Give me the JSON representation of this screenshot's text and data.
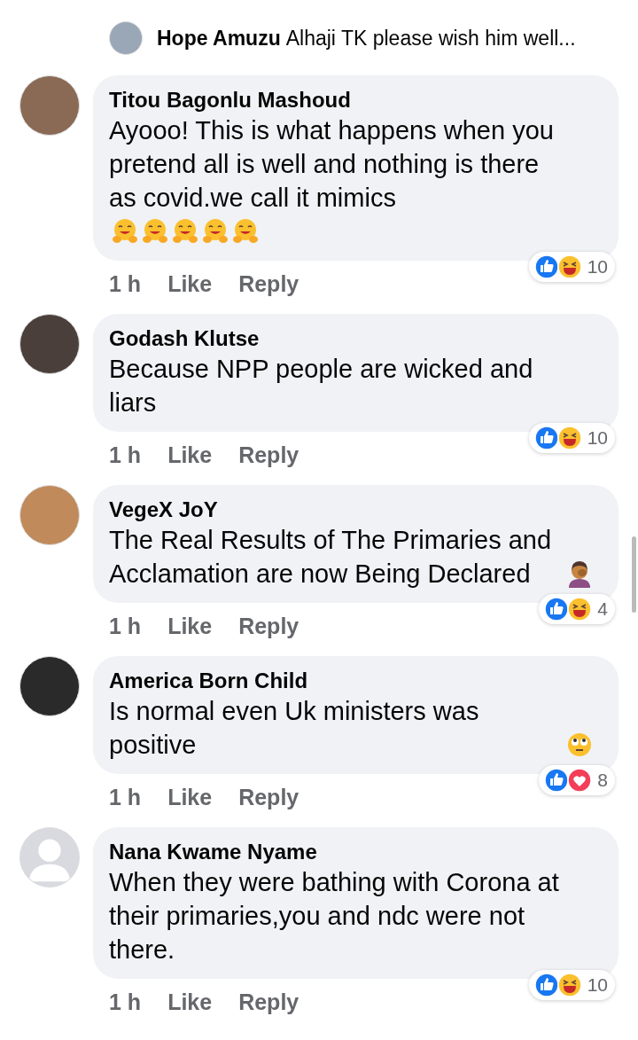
{
  "reply_preview": {
    "author": "Hope Amuzu",
    "text": "Alhaji TK please wish him well...",
    "avatar": {
      "kind": "photo"
    }
  },
  "comments": [
    {
      "author": "Titou Bagonlu Mashoud",
      "avatar": {
        "kind": "photo"
      },
      "text": "Ayooo! This is what happens when you pretend all is well and nothing is there as covid.we call it mimics",
      "emojis": [
        {
          "kind": "hug"
        },
        {
          "kind": "hug"
        },
        {
          "kind": "hug"
        },
        {
          "kind": "hug"
        },
        {
          "kind": "hug"
        }
      ],
      "time": "1 h",
      "like": "Like",
      "reply": "Reply",
      "reactions": [
        {
          "kind": "like"
        },
        {
          "kind": "haha"
        }
      ],
      "count": "10"
    },
    {
      "author": "Godash Klutse",
      "avatar": {
        "kind": "photo"
      },
      "text": "Because NPP people are wicked and liars",
      "time": "1 h",
      "like": "Like",
      "reply": "Reply",
      "reactions": [
        {
          "kind": "like"
        },
        {
          "kind": "haha"
        }
      ],
      "count": "10"
    },
    {
      "author": "VegeX JoY",
      "avatar": {
        "kind": "photo"
      },
      "text": "The Real Results of The Primaries and Acclamation are now Being Declared",
      "emojis": [
        {
          "kind": "facepalm"
        }
      ],
      "time": "1 h",
      "like": "Like",
      "reply": "Reply",
      "reactions": [
        {
          "kind": "like"
        },
        {
          "kind": "haha"
        }
      ],
      "count": "4"
    },
    {
      "author": "America Born Child",
      "avatar": {
        "kind": "photo"
      },
      "text": "Is normal even Uk ministers was positive",
      "emojis": [
        {
          "kind": "eyeroll"
        }
      ],
      "time": "1 h",
      "like": "Like",
      "reply": "Reply",
      "reactions": [
        {
          "kind": "like"
        },
        {
          "kind": "love"
        }
      ],
      "count": "8"
    },
    {
      "author": "Nana Kwame Nyame",
      "avatar": {
        "kind": "silhouette"
      },
      "text": "When they were bathing with Corona at their primaries,you and ndc were not there.",
      "time": "1 h",
      "like": "Like",
      "reply": "Reply",
      "reactions": [
        {
          "kind": "like"
        },
        {
          "kind": "haha"
        }
      ],
      "count": "10"
    }
  ]
}
